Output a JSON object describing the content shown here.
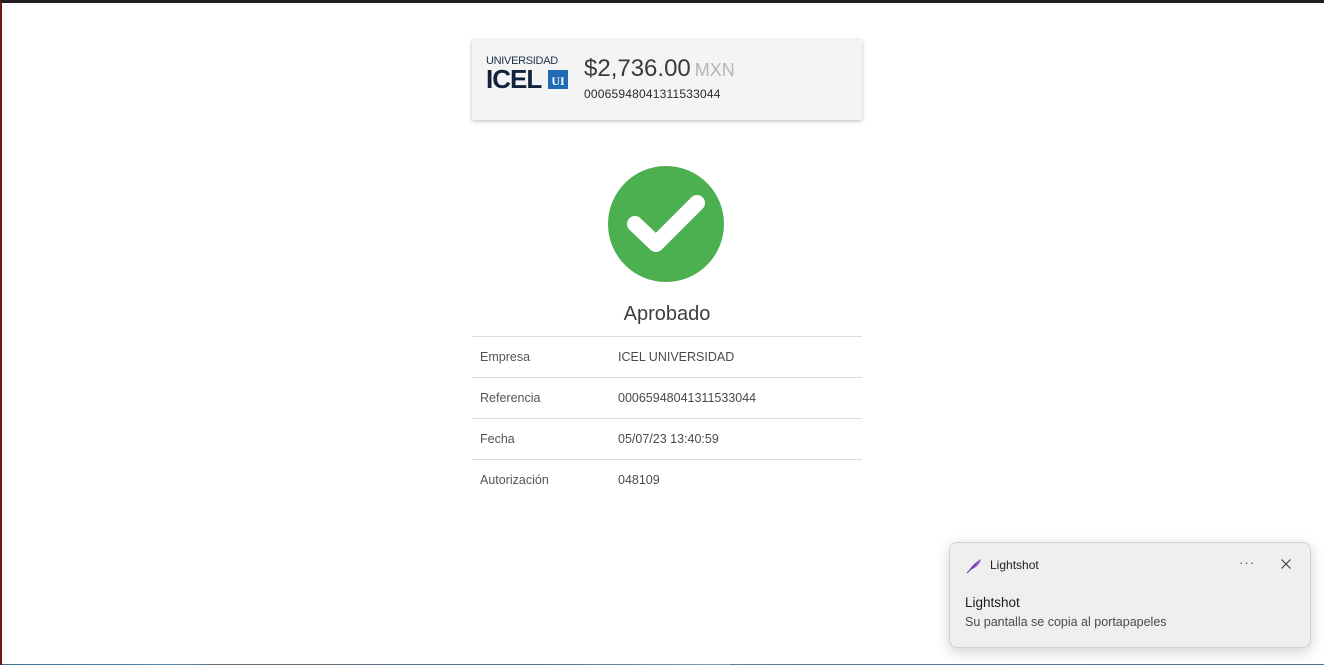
{
  "header_card": {
    "logo": {
      "line1": "UNIVERSIDAD",
      "line2": "ICEL",
      "badge": "UI",
      "brand_color": "#14233d",
      "badge_color": "#1f6bb5"
    },
    "amount": "$2,736.00",
    "currency": "MXN",
    "reference": "00065948041311533044"
  },
  "status": {
    "icon": "checkmark-icon",
    "color": "#4caf50",
    "label": "Aprobado"
  },
  "details": [
    {
      "key": "Empresa",
      "value": "ICEL UNIVERSIDAD"
    },
    {
      "key": "Referencia",
      "value": "00065948041311533044"
    },
    {
      "key": "Fecha",
      "value": "05/07/23 13:40:59"
    },
    {
      "key": "Autorización",
      "value": "048109"
    }
  ],
  "toast": {
    "app_icon": "feather-icon",
    "app_name": "Lightshot",
    "more_label": "···",
    "close_icon": "close-icon",
    "title": "Lightshot",
    "body": "Su pantalla se copia al portapapeles"
  }
}
